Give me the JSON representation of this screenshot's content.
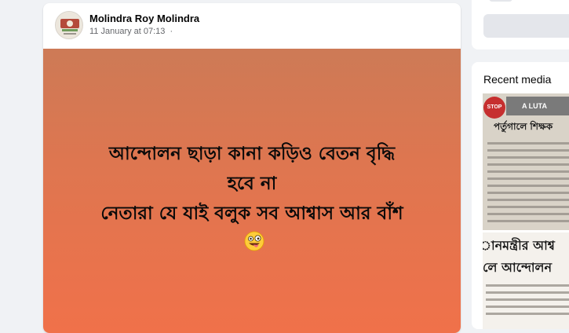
{
  "post": {
    "author_name": "Molindra Roy Molindra",
    "timestamp": "11 January at 07:13",
    "audience_separator": "·",
    "lines": [
      "আন্দোলন ছাড়া কানা কড়িও বেতন বৃদ্ধি",
      "হবে না",
      "নেতারা যে যাই বলুক সব আশ্বাস আর বাঁশ"
    ],
    "emoji": "zany-face-icon",
    "background_gradient": [
      "#cd7a56",
      "#de7650",
      "#f0714a"
    ]
  },
  "sidebar": {
    "recent_media_title": "Recent media",
    "thumb1": {
      "stop_text": "STOP",
      "banner_text": "A LUTA",
      "headline": "পর্তুগালে শিক্ষক"
    },
    "thumb2": {
      "headline_1": "ানমন্ত্রীর আশ্ব",
      "headline_2": "লে আন্দোলন"
    }
  }
}
